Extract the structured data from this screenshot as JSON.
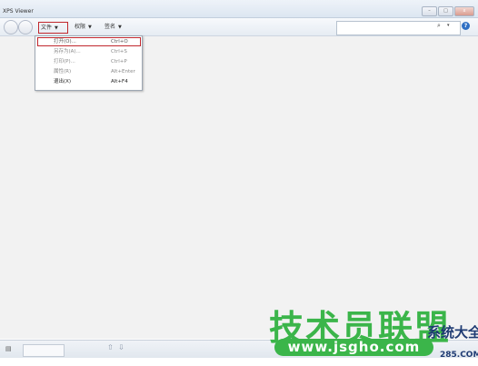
{
  "window": {
    "title": "XPS Viewer",
    "minimize": "–",
    "maximize": "□",
    "close": "x"
  },
  "toolbar": {
    "file_label": "文件",
    "permissions_label": "权限",
    "signatures_label": "签名",
    "caret": "▼"
  },
  "search": {
    "value": "",
    "icon": "⌕",
    "caret": "▾"
  },
  "help": {
    "label": "?"
  },
  "file_menu": {
    "items": [
      {
        "label": "打开(O)...",
        "shortcut": "Ctrl+O"
      },
      {
        "label": "另存为(A)...",
        "shortcut": "Ctrl+S"
      },
      {
        "label": "打印(P)...",
        "shortcut": "Ctrl+P"
      },
      {
        "label": "属性(R)",
        "shortcut": "Alt+Enter"
      },
      {
        "label": "退出(X)",
        "shortcut": "Alt+F4"
      }
    ]
  },
  "statusbar": {
    "page_value": "",
    "up": "⇧",
    "down": "⇩"
  },
  "watermark": {
    "main": "技术员联盟",
    "side": "系统大全",
    "url": "www.jsgho.com",
    "url2": "285.COM"
  },
  "colors": {
    "highlight_red": "#c1272d",
    "watermark_green": "#3bb54a",
    "watermark_blue": "#1f3b73"
  }
}
